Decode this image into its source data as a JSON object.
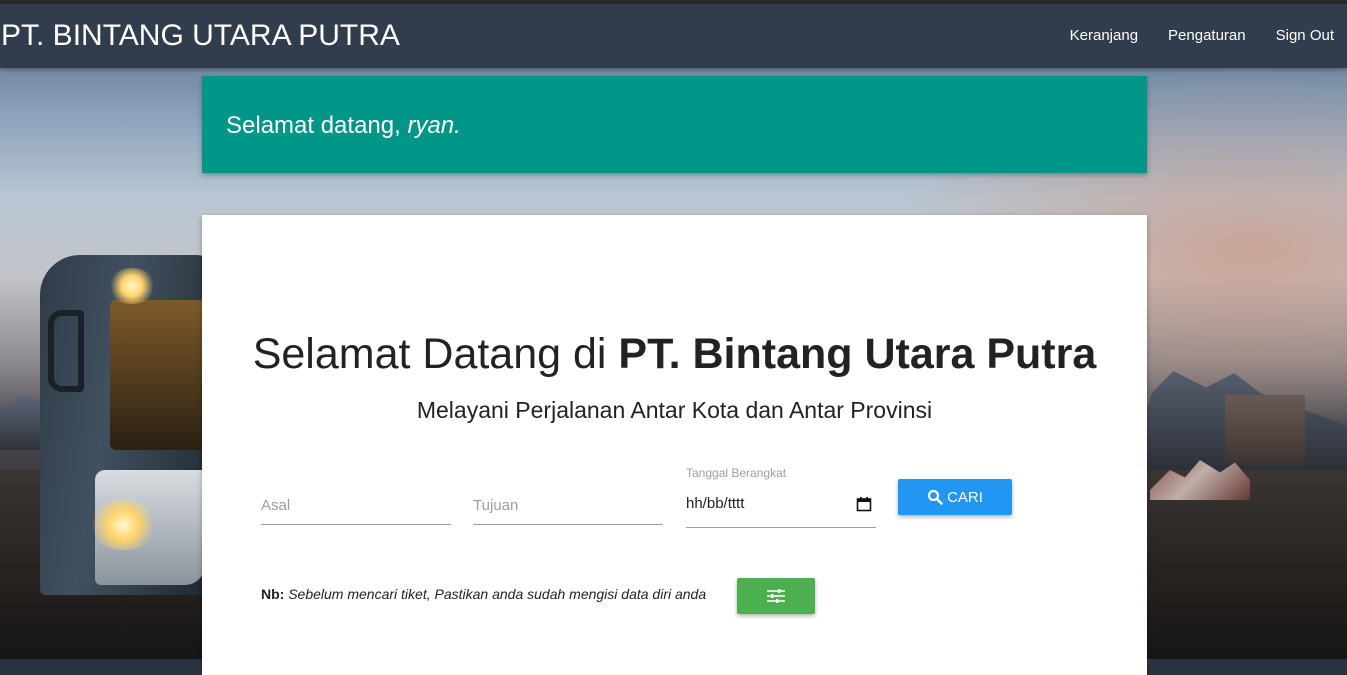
{
  "brand": "PT. BINTANG UTARA PUTRA",
  "nav": {
    "cart": "Keranjang",
    "settings": "Pengaturan",
    "signout": "Sign Out"
  },
  "welcome": {
    "greeting": "Selamat datang,",
    "user": "ryan."
  },
  "hero": {
    "title_regular": "Selamat Datang di",
    "title_bold": "PT. Bintang Utara Putra",
    "subtitle": "Melayani Perjalanan Antar Kota dan Antar Provinsi"
  },
  "search": {
    "origin_placeholder": "Asal",
    "destination_placeholder": "Tujuan",
    "date_label": "Tanggal Berangkat",
    "date_value": "hh/bb/tttt",
    "search_button": "CARI"
  },
  "note": {
    "prefix": "Nb:",
    "text": "Sebelum mencari tiket, Pastikan anda sudah mengisi data diri anda"
  },
  "icons": {
    "search": "search-icon",
    "calendar": "calendar-icon",
    "settings": "sliders-icon"
  },
  "colors": {
    "navbar": "#313c4d",
    "welcome": "#009688",
    "search_button": "#2196f3",
    "settings_button": "#4caf50"
  }
}
